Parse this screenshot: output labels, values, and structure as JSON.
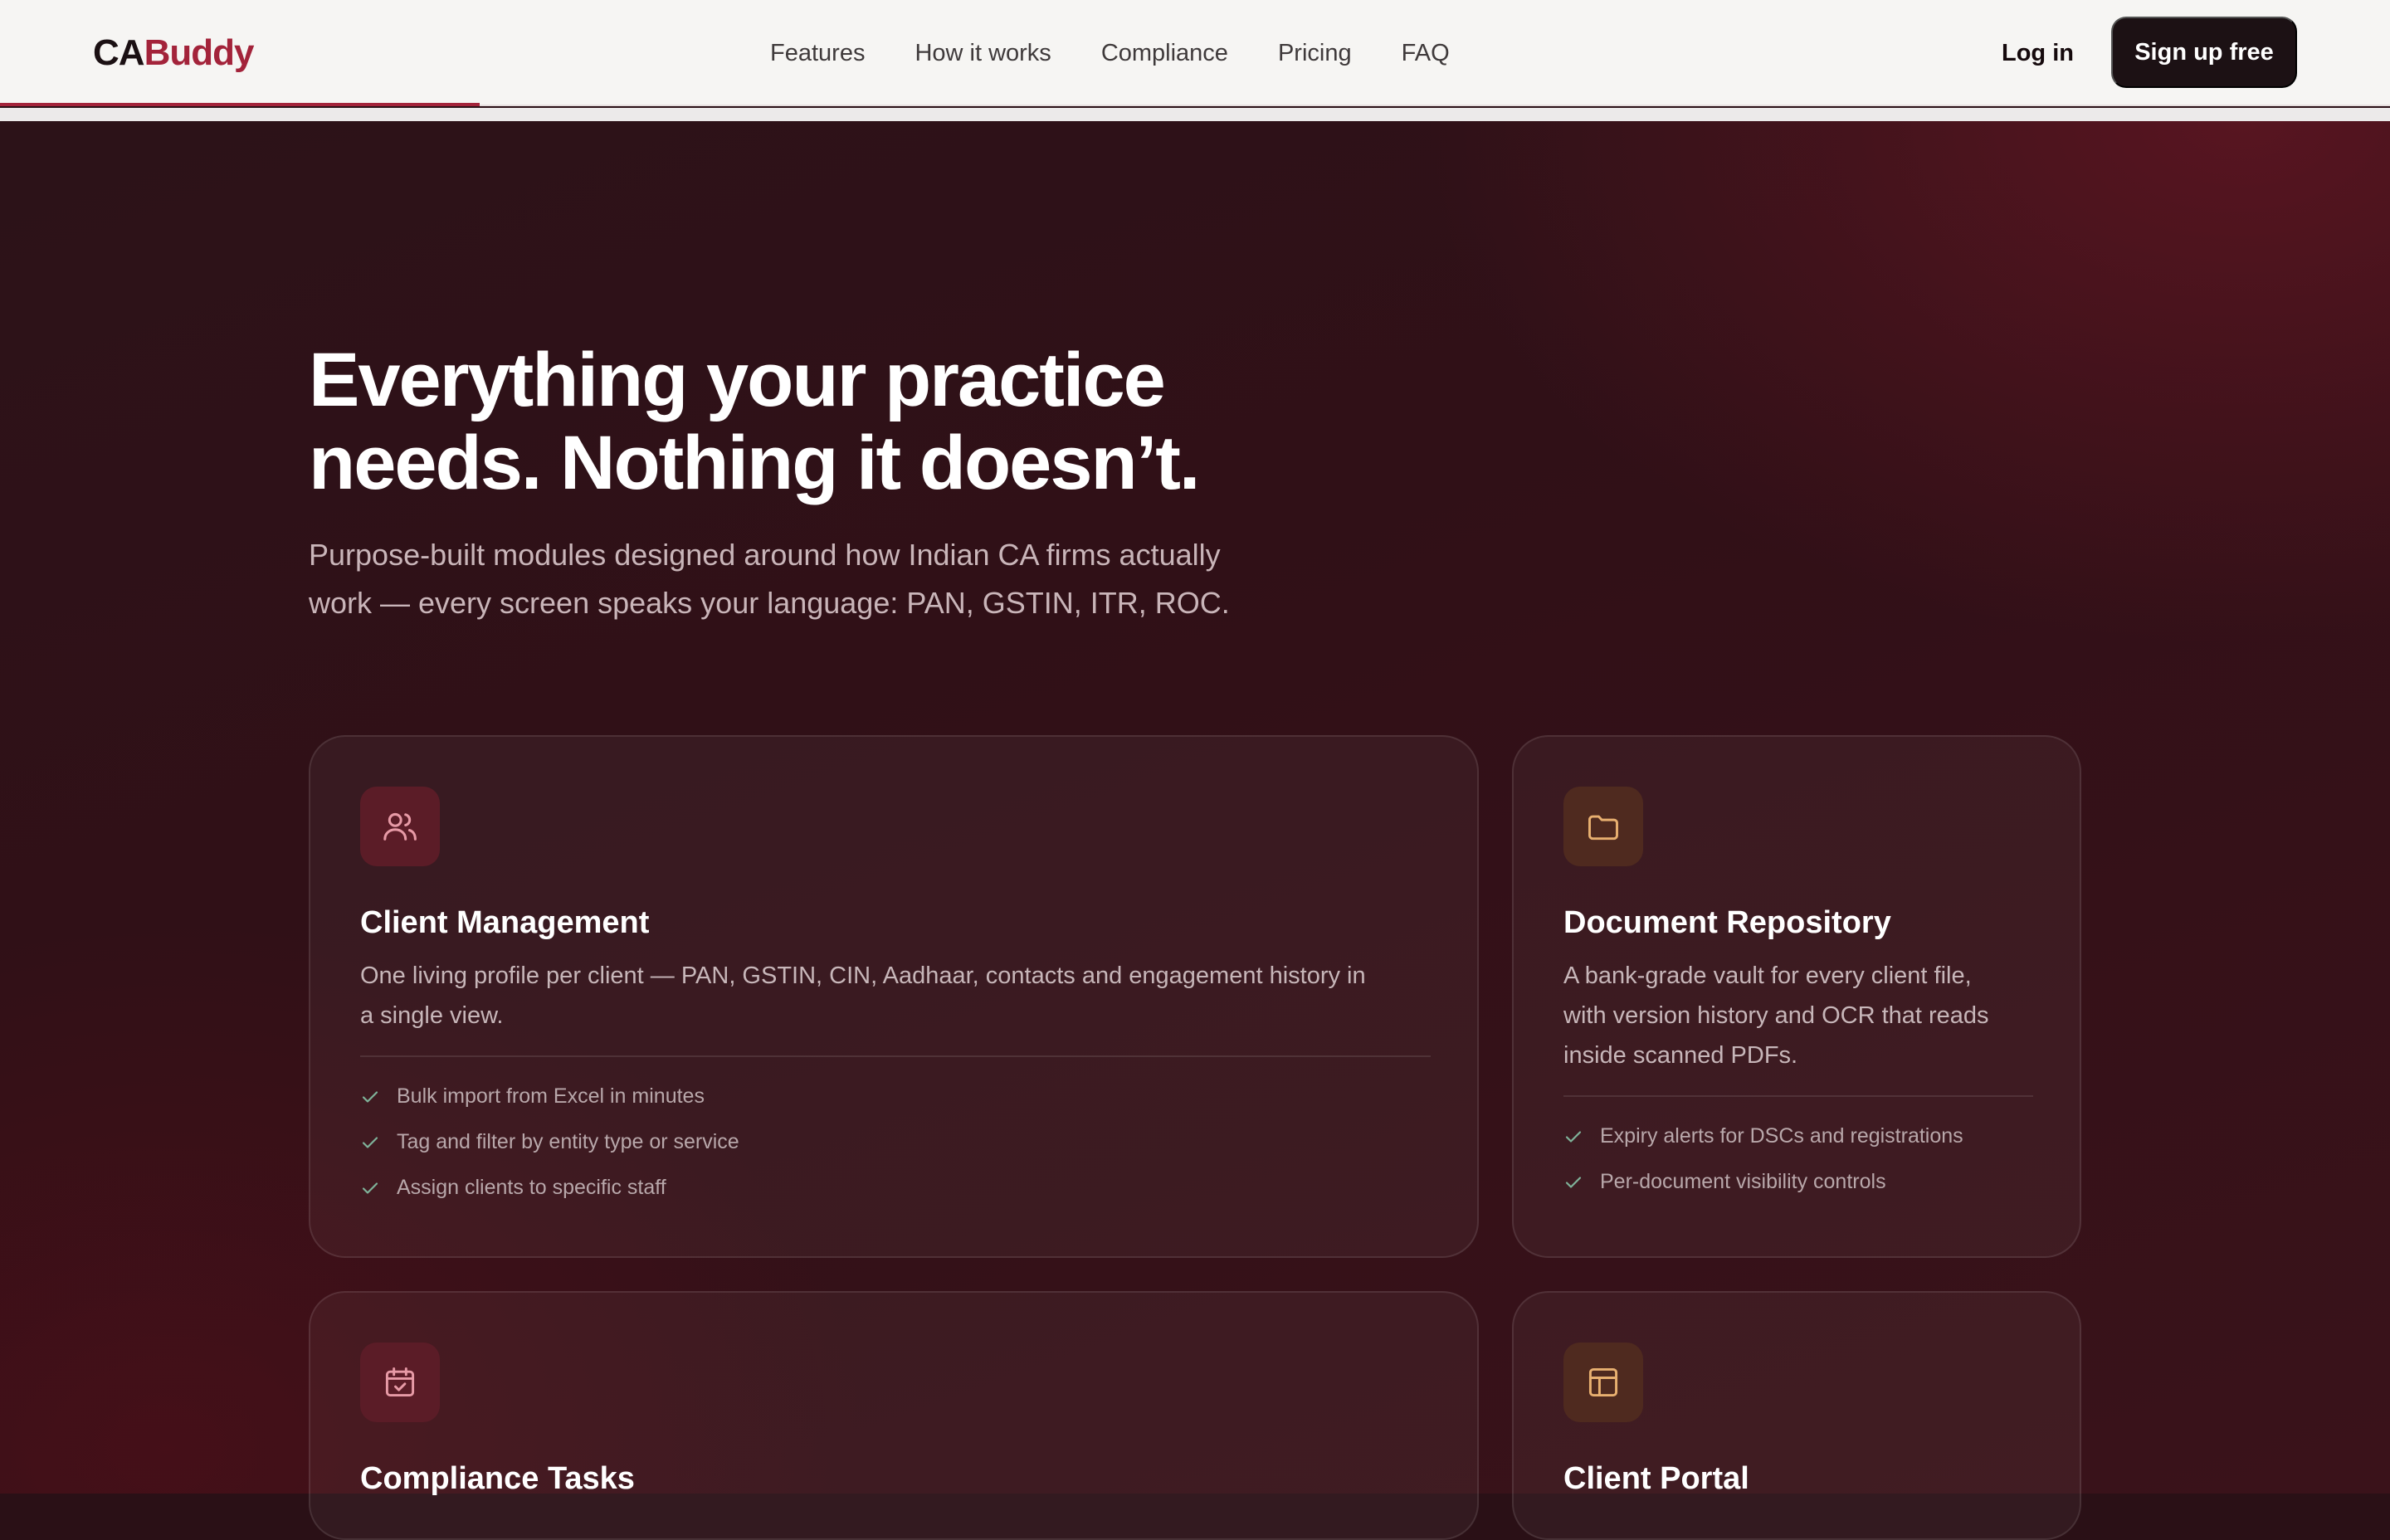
{
  "brand": {
    "part1": "CA",
    "part2": "Buddy"
  },
  "nav": {
    "links": [
      "Features",
      "How it works",
      "Compliance",
      "Pricing",
      "FAQ"
    ],
    "login": "Log in",
    "signup": "Sign up free"
  },
  "hero": {
    "title_line1": "Everything your practice",
    "title_line2": "needs. Nothing it doesn’t.",
    "subtitle_line1": "Purpose-built modules designed around how Indian CA firms actually",
    "subtitle_line2": "work — every screen speaks your language: PAN, GSTIN, ITR, ROC."
  },
  "cards": [
    {
      "icon": "users-icon",
      "title": "Client Management",
      "desc_line1": "One living profile per client — PAN, GSTIN, CIN, Aadhaar, contacts and engagement history in",
      "desc_line2": "a single view.",
      "features": [
        "Bulk import from Excel in minutes",
        "Tag and filter by entity type or service",
        "Assign clients to specific staff"
      ]
    },
    {
      "icon": "folder-icon",
      "title": "Document Repository",
      "desc_line1": "A bank-grade vault for every client file,",
      "desc_line2": "with version history and OCR that reads",
      "desc_line3": "inside scanned PDFs.",
      "features": [
        "Expiry alerts for DSCs and registrations",
        "Per-document visibility controls"
      ]
    },
    {
      "icon": "calendar-check-icon",
      "title": "Compliance Tasks"
    },
    {
      "icon": "layout-icon",
      "title": "Client Portal"
    }
  ],
  "colors": {
    "accent": "#a3233a",
    "hero_bg": "#311017",
    "nav_bg": "#f6f5f3",
    "check": "#7fb39a",
    "icon_red": "#e79aa6",
    "icon_amber": "#e8b070"
  }
}
